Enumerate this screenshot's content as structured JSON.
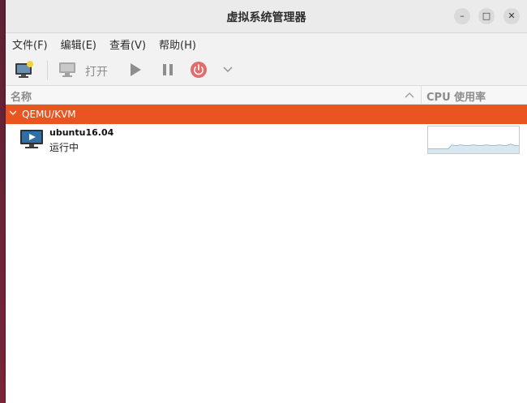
{
  "window": {
    "title": "虚拟系统管理器",
    "controls": {
      "minimize": "–",
      "maximize": "□",
      "close": "✕"
    }
  },
  "menubar": {
    "items": [
      {
        "label": "文件(F)"
      },
      {
        "label": "编辑(E)"
      },
      {
        "label": "查看(V)"
      },
      {
        "label": "帮助(H)"
      }
    ]
  },
  "toolbar": {
    "new_vm_icon": "new-vm-icon",
    "open_label": "打开",
    "play_icon": "play-icon",
    "pause_icon": "pause-icon",
    "power_icon": "power-icon",
    "dropdown_icon": "chevron-down-icon",
    "power_color": "#e46b6b"
  },
  "columns": {
    "name": "名称",
    "cpu": "CPU 使用率"
  },
  "connection": {
    "label": "QEMU/KVM",
    "color": "#e95420"
  },
  "vms": [
    {
      "name": "ubuntu16.04",
      "status": "运行中",
      "cpu_graph_color": "#6d9fbd"
    }
  ]
}
